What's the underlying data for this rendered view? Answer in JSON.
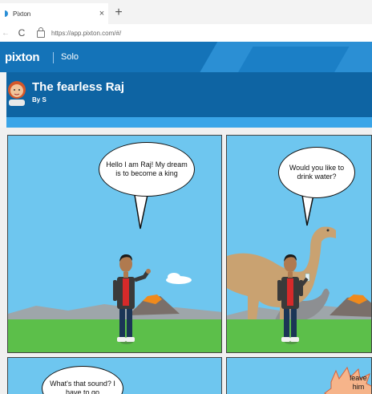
{
  "browser": {
    "tab_title": "Pixton",
    "tab_close": "×",
    "new_tab": "+",
    "back": "←",
    "reload": "C",
    "url": "https://app.pixton.com/#/"
  },
  "header": {
    "brand": "pixton",
    "mode": "Solo"
  },
  "comic": {
    "title": "The fearless Raj",
    "author": "By S"
  },
  "panels": [
    {
      "bubble": "Hello I am Raj! My dream is to become a king"
    },
    {
      "bubble": "Would you like to drink water?"
    },
    {
      "bubble": "What's that sound? I have to go"
    },
    {
      "bubble": "leave him"
    }
  ],
  "colors": {
    "brand_blue": "#1473b8",
    "title_blue": "#0e64a3",
    "accent_blue": "#3aa5e8",
    "sky": "#6ec6ef",
    "grass": "#5cbf4a"
  }
}
